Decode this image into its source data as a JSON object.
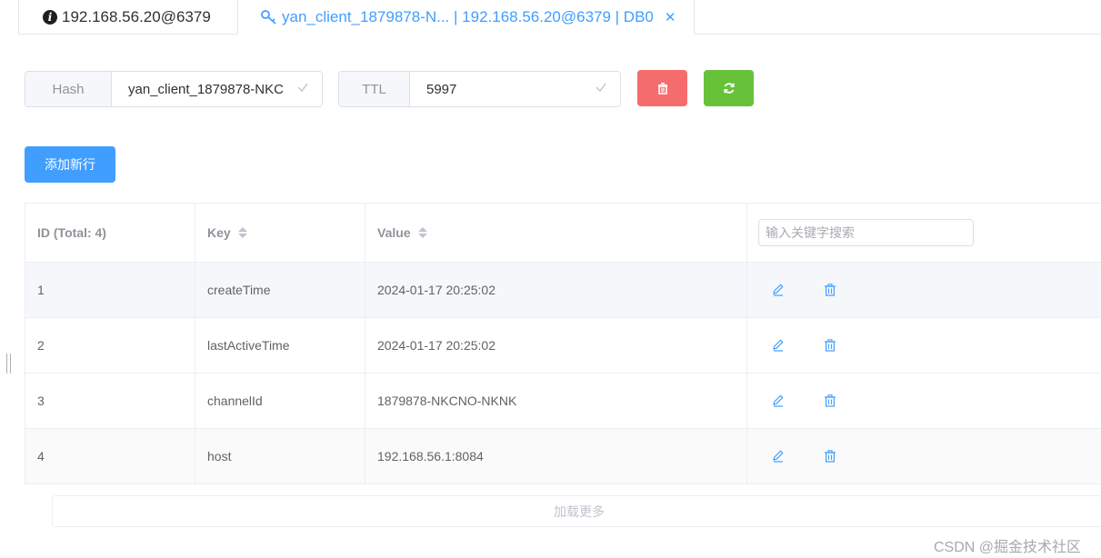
{
  "tabs": [
    {
      "label": "192.168.56.20@6379",
      "icon": "info-icon"
    },
    {
      "label": "yan_client_1879878-N... | 192.168.56.20@6379 | DB0",
      "icon": "key-icon",
      "active": true
    }
  ],
  "key_type": "Hash",
  "key_name": "yan_client_1879878-NKC",
  "ttl_label": "TTL",
  "ttl_value": "5997",
  "add_row_label": "添加新行",
  "table": {
    "columns": {
      "id": "ID (Total: 4)",
      "key": "Key",
      "value": "Value"
    },
    "search_placeholder": "输入关键字搜索",
    "rows": [
      {
        "id": "1",
        "key": "createTime",
        "value": "2024-01-17 20:25:02"
      },
      {
        "id": "2",
        "key": "lastActiveTime",
        "value": "2024-01-17 20:25:02"
      },
      {
        "id": "3",
        "key": "channelId",
        "value": "1879878-NKCNO-NKNK"
      },
      {
        "id": "4",
        "key": "host",
        "value": "192.168.56.1:8084"
      }
    ]
  },
  "load_more_label": "加载更多",
  "watermark": "CSDN @掘金技术社区",
  "colors": {
    "primary": "#409eff",
    "danger": "#f56c6c",
    "success": "#67c23a"
  }
}
